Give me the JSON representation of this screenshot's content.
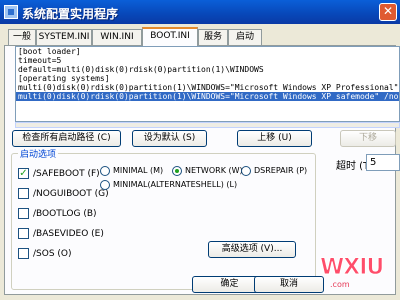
{
  "window": {
    "title": "系统配置实用程序",
    "close_symbol": "✕"
  },
  "tabs": [
    {
      "label": "一般"
    },
    {
      "label": "SYSTEM.INI"
    },
    {
      "label": "WIN.INI"
    },
    {
      "label": "BOOT.INI",
      "active": true
    },
    {
      "label": "服务"
    },
    {
      "label": "启动"
    }
  ],
  "boot_ini": {
    "lines": [
      "[boot loader]",
      "timeout=5",
      "default=multi(0)disk(0)rdisk(0)partition(1)\\WINDOWS",
      "[operating systems]",
      "multi(0)disk(0)rdisk(0)partition(1)\\WINDOWS=\"Microsoft Windows XP Professional\"",
      "multi(0)disk(0)rdisk(0)partition(1)\\WINDOWS=\"Microsoft Windows XP safemode\" /noe"
    ],
    "selected_index": 5
  },
  "buttons": {
    "check_paths": "检查所有启动路径 (C)",
    "set_default": "设为默认 (S)",
    "move_up": "上移 (U)",
    "move_down": "下移",
    "advanced": "高级选项 (V)...",
    "ok": "确定",
    "cancel": "取消"
  },
  "boot_options": {
    "legend": "启动选项",
    "checkboxes": [
      {
        "label": "/SAFEBOOT (F)",
        "checked": true
      },
      {
        "label": "/NOGUIBOOT (G)",
        "checked": false
      },
      {
        "label": "/BOOTLOG (B)",
        "checked": false
      },
      {
        "label": "/BASEVIDEO (E)",
        "checked": false
      },
      {
        "label": "/SOS (O)",
        "checked": false
      }
    ],
    "radios": [
      {
        "label": "MINIMAL (M)",
        "selected": false
      },
      {
        "label": "NETWORK (W)",
        "selected": true
      },
      {
        "label": "DSREPAIR (P)",
        "selected": false
      },
      {
        "label": "MINIMAL(ALTERNATESHELL) (L)",
        "selected": false
      }
    ]
  },
  "timeout": {
    "label": "超时 (T):",
    "value": "5"
  },
  "watermark": {
    "brand": "WXIU",
    "sub": ".com"
  }
}
